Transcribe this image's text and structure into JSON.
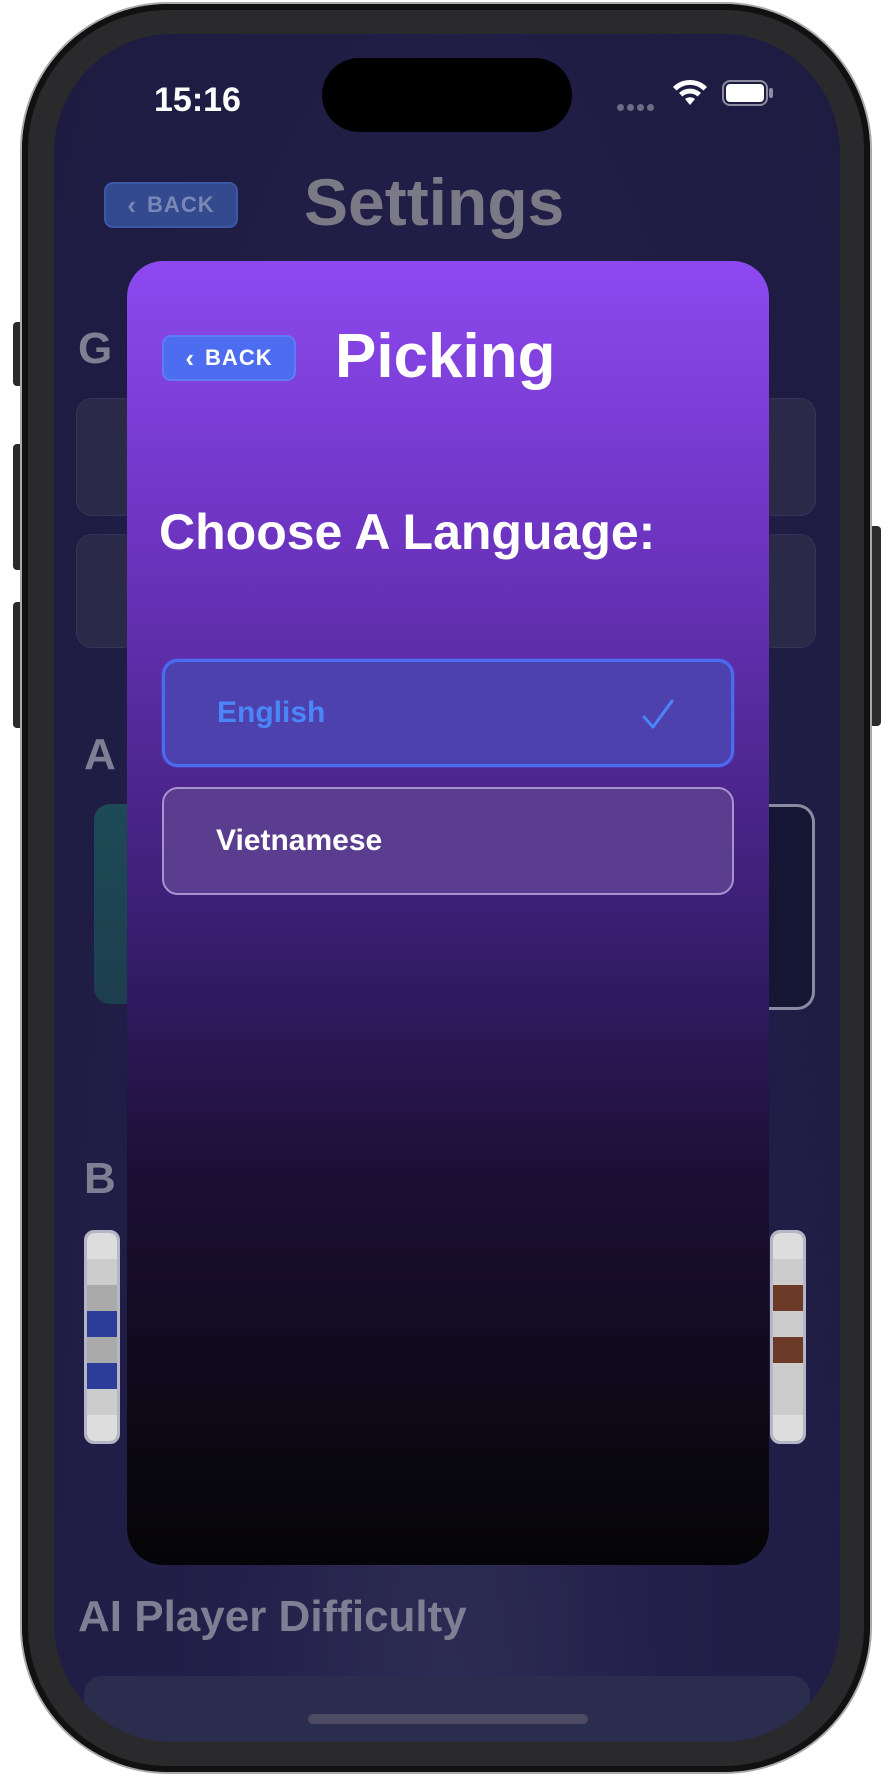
{
  "status_bar": {
    "time": "15:16"
  },
  "background_page": {
    "back_label": "BACK",
    "title": "Settings",
    "section_1_initial": "G",
    "section_2_initial": "A",
    "section_3_initial": "B",
    "section_4": "AI Player Difficulty"
  },
  "modal": {
    "back_label": "BACK",
    "title": "Picking",
    "heading": "Choose A Language:",
    "options": [
      {
        "label": "English",
        "selected": true
      },
      {
        "label": "Vietnamese",
        "selected": false
      }
    ]
  },
  "colors": {
    "accent": "#4b6cf0",
    "selected_text": "#4a86f7",
    "sheet_top": "#8d49ef",
    "screen_bg": "#22204a"
  },
  "icons": [
    "chevron-left-icon",
    "checkmark-icon",
    "wifi-icon",
    "battery-icon",
    "signal-dots-icon"
  ]
}
